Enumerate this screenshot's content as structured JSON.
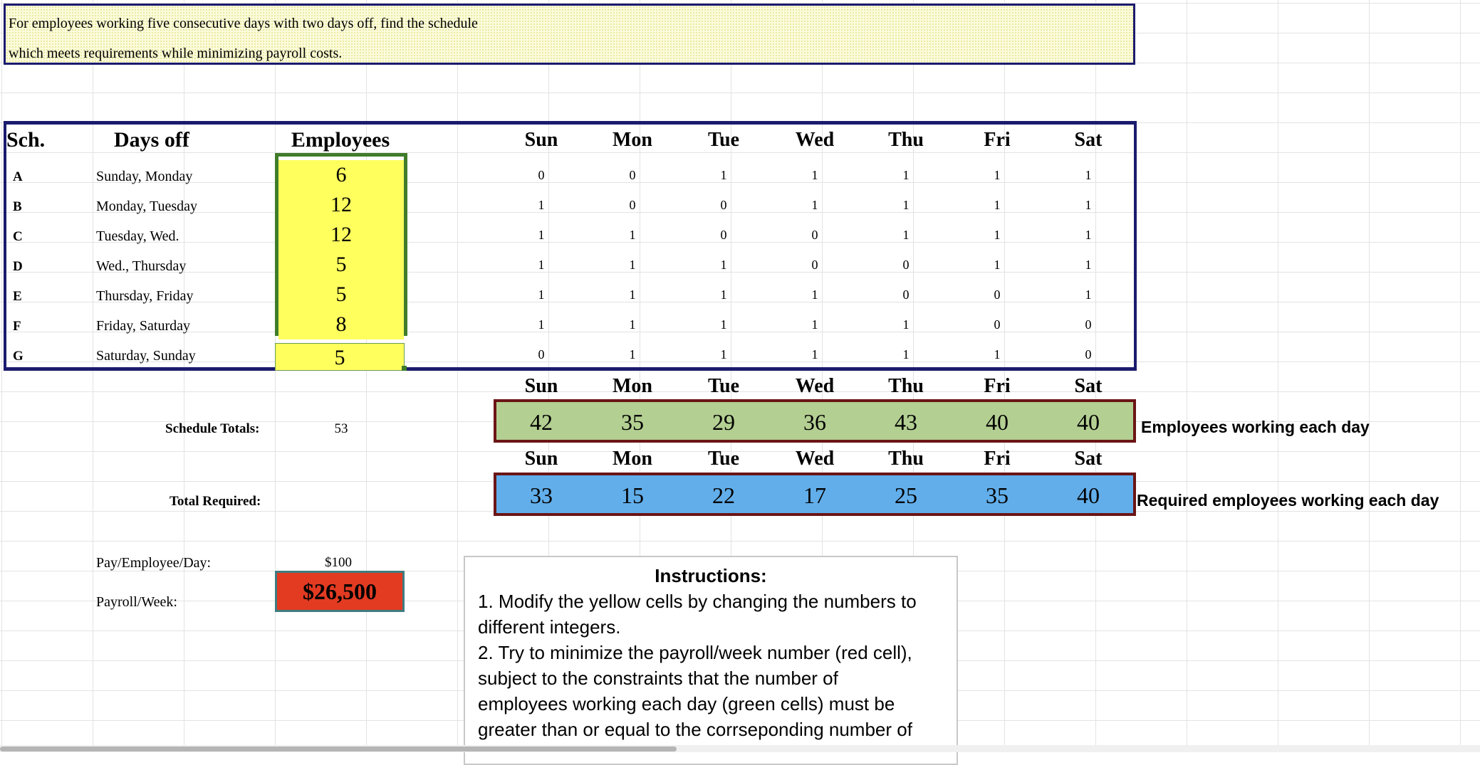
{
  "problem": {
    "line1": "For employees working five consecutive days with two days off, find the schedule",
    "line2": "which meets requirements  while minimizing payroll costs."
  },
  "headers": {
    "sch": "Sch.",
    "days_off": "Days off",
    "employees": "Employees"
  },
  "days": [
    "Sun",
    "Mon",
    "Tue",
    "Wed",
    "Thu",
    "Fri",
    "Sat"
  ],
  "schedules": [
    {
      "id": "A",
      "days_off": "Sunday, Monday",
      "employees": "6",
      "work": [
        "0",
        "0",
        "1",
        "1",
        "1",
        "1",
        "1"
      ]
    },
    {
      "id": "B",
      "days_off": "Monday, Tuesday",
      "employees": "12",
      "work": [
        "1",
        "0",
        "0",
        "1",
        "1",
        "1",
        "1"
      ]
    },
    {
      "id": "C",
      "days_off": "Tuesday, Wed.",
      "employees": "12",
      "work": [
        "1",
        "1",
        "0",
        "0",
        "1",
        "1",
        "1"
      ]
    },
    {
      "id": "D",
      "days_off": "Wed., Thursday",
      "employees": "5",
      "work": [
        "1",
        "1",
        "1",
        "0",
        "0",
        "1",
        "1"
      ]
    },
    {
      "id": "E",
      "days_off": "Thursday, Friday",
      "employees": "5",
      "work": [
        "1",
        "1",
        "1",
        "1",
        "0",
        "0",
        "1"
      ]
    },
    {
      "id": "F",
      "days_off": "Friday, Saturday",
      "employees": "8",
      "work": [
        "1",
        "1",
        "1",
        "1",
        "1",
        "0",
        "0"
      ]
    },
    {
      "id": "G",
      "days_off": "Saturday, Sunday",
      "employees": "5",
      "work": [
        "0",
        "1",
        "1",
        "1",
        "1",
        "1",
        "0"
      ]
    }
  ],
  "totals": {
    "schedule_label": "Schedule Totals:",
    "schedule_value": "53",
    "required_label": "Total Required:",
    "working": [
      "42",
      "35",
      "29",
      "36",
      "43",
      "40",
      "40"
    ],
    "required": [
      "33",
      "15",
      "22",
      "17",
      "25",
      "35",
      "40"
    ],
    "working_caption": "Employees working each day",
    "required_caption": "Required employees working each day"
  },
  "pay": {
    "pay_label": "Pay/Employee/Day:",
    "pay_value": "$100",
    "payroll_label": "Payroll/Week:",
    "payroll_value": "$26,500"
  },
  "instructions": {
    "title": "Instructions:",
    "lines": [
      "1. Modify the yellow cells by changing the numbers to",
      "different integers.",
      "2. Try to minimize the payroll/week number (red cell),",
      "subject to the constraints that the number of",
      "employees working each day (green cells)  must be",
      "greater than or equal to the corrseponding number of"
    ]
  },
  "colors": {
    "input_yellow": "#ffff5e",
    "working_green": "#b3cf92",
    "required_blue": "#62aeea",
    "payroll_red": "#e23b22",
    "border_navy": "#1b1b6e"
  }
}
